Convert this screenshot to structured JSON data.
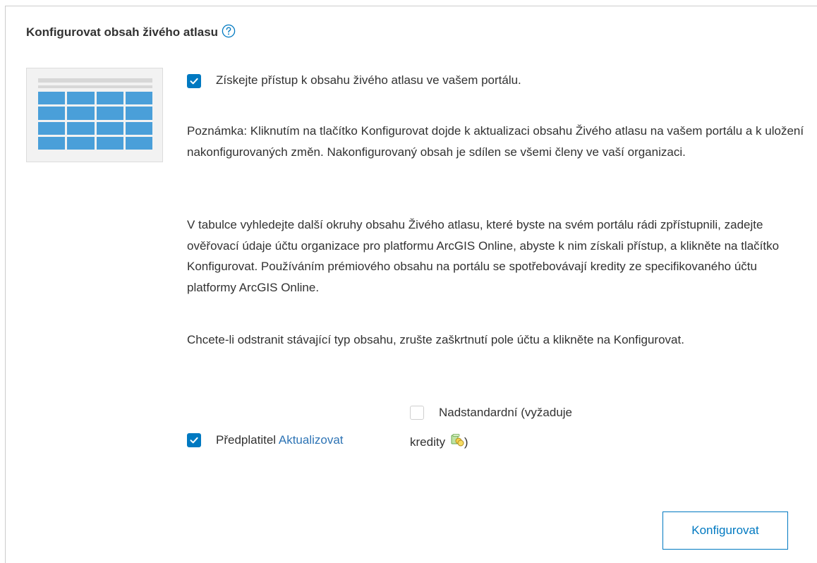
{
  "title": "Konfigurovat obsah živého atlasu",
  "icons": {
    "help": "help-circle-icon",
    "checkmark": "checkmark-icon",
    "credits": "credits-coins-icon"
  },
  "colors": {
    "accent": "#0079c1",
    "link": "#2e74b5",
    "thumbnail_tiles": "#4a9fd9"
  },
  "access_checkbox": {
    "checked": true,
    "label": "Získejte přístup k obsahu živého atlasu ve vašem portálu."
  },
  "paragraphs": {
    "note": "Poznámka: Kliknutím na tlačítko Konfigurovat dojde k aktualizaci obsahu Živého atlasu na vašem portálu a k uložení nakonfigurovaných změn. Nakonfigurovaný obsah je sdílen se všemi členy ve vaší organizaci.",
    "table_info": "V tabulce vyhledejte další okruhy obsahu Živého atlasu, které byste na svém portálu rádi zpřístupnili, zadejte ověřovací údaje účtu organizace pro platformu ArcGIS Online, abyste k nim získali přístup, a klikněte na tlačítko Konfigurovat. Používáním prémiového obsahu na portálu se spotřebovávají kredity ze specifikovaného účtu platformy ArcGIS Online.",
    "remove_info": "Chcete-li odstranit stávající typ obsahu, zrušte zaškrtnutí pole účtu a klikněte na Konfigurovat."
  },
  "subscriber": {
    "checked": true,
    "label": "Předplatitel",
    "link": "Aktualizovat"
  },
  "premium": {
    "checked": false,
    "label_line1": "Nadstandardní (vyžaduje",
    "label_line2": "kredity",
    "label_suffix": ")"
  },
  "configure_button": "Konfigurovat"
}
